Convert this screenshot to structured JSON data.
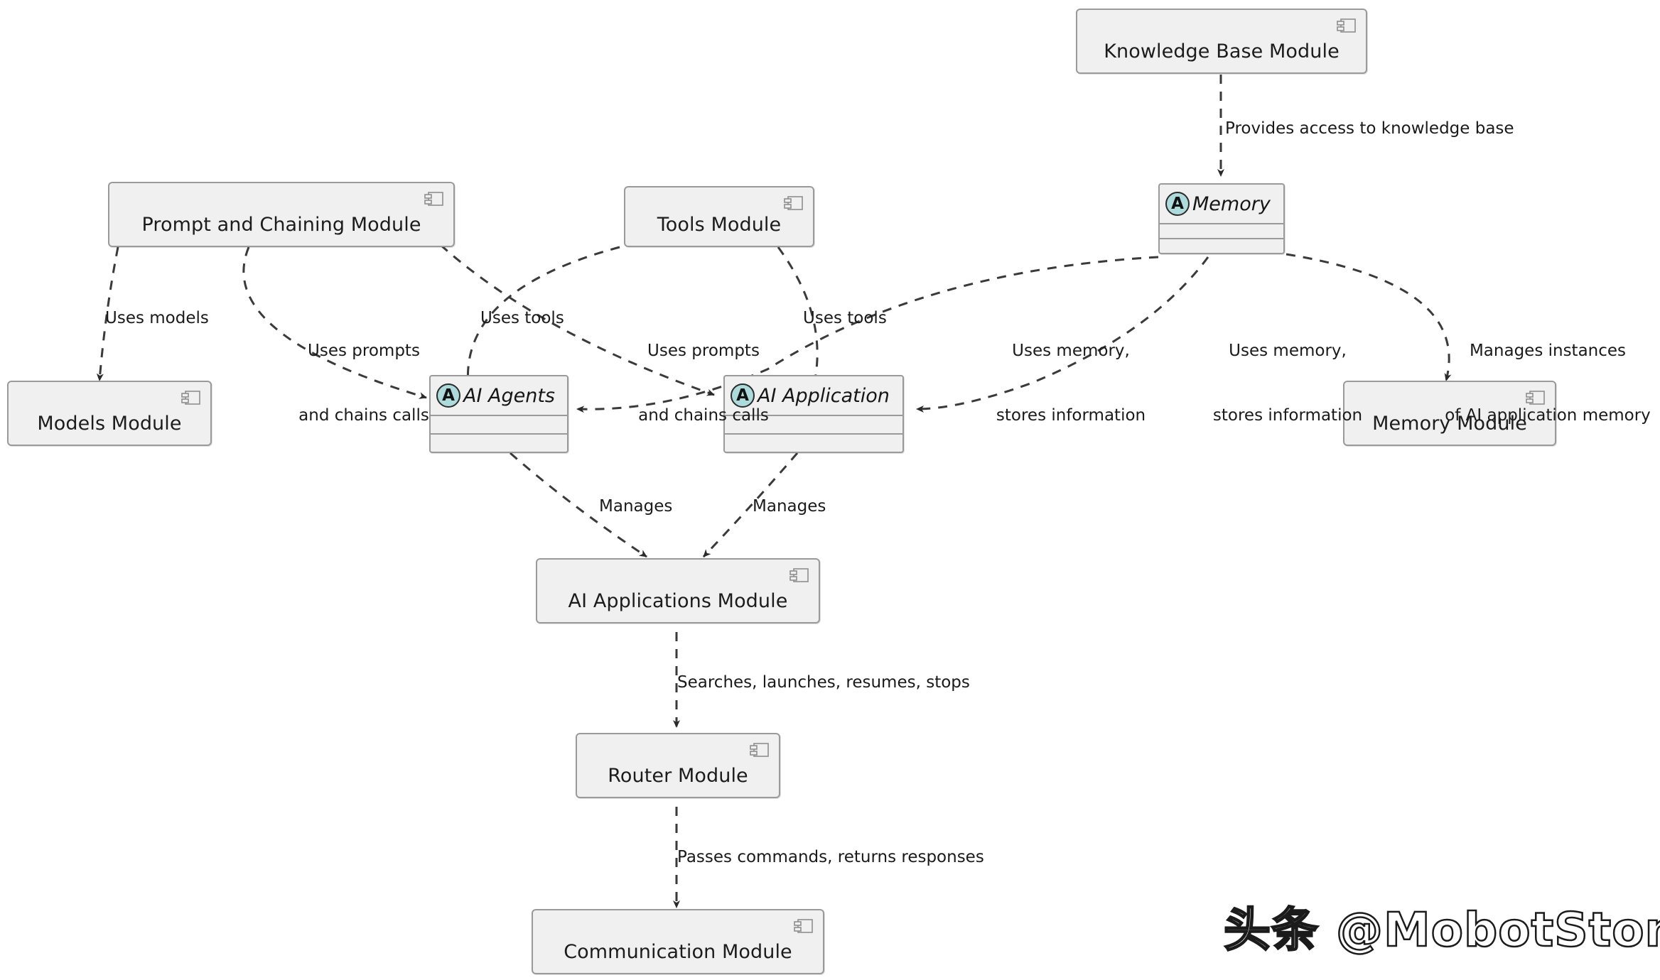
{
  "diagram": {
    "type": "uml-component-diagram",
    "background": "#ffffff",
    "node_fill": "#F0F0F0",
    "node_border": "#9A9A9A",
    "abstract_badge_fill": "#ADDBDB",
    "edge_color": "#3a3a3a",
    "edge_style": "dashed-with-arrowhead"
  },
  "nodes": {
    "knowledge_base_module": {
      "label": "Knowledge Base Module",
      "kind": "component"
    },
    "prompt_chaining_module": {
      "label": "Prompt and Chaining Module",
      "kind": "component"
    },
    "tools_module": {
      "label": "Tools Module",
      "kind": "component"
    },
    "models_module": {
      "label": "Models Module",
      "kind": "component"
    },
    "memory_module": {
      "label": "Memory Module",
      "kind": "component"
    },
    "ai_applications_module": {
      "label": "AI Applications Module",
      "kind": "component"
    },
    "router_module": {
      "label": "Router Module",
      "kind": "component"
    },
    "communication_module": {
      "label": "Communication Module",
      "kind": "component"
    },
    "memory": {
      "label": "Memory",
      "kind": "abstract-class",
      "badge": "A"
    },
    "ai_agents": {
      "label": "AI Agents",
      "kind": "abstract-class",
      "badge": "A"
    },
    "ai_application": {
      "label": "AI Application",
      "kind": "abstract-class",
      "badge": "A"
    }
  },
  "edges": [
    {
      "id": "kb-to-memory",
      "from": "knowledge_base_module",
      "to": "memory",
      "label": "Provides access to knowledge base"
    },
    {
      "id": "prompt-to-models",
      "from": "prompt_chaining_module",
      "to": "models_module",
      "label": "Uses models"
    },
    {
      "id": "prompt-to-agents",
      "from": "prompt_chaining_module",
      "to": "ai_agents",
      "label_line1": "Uses prompts",
      "label_line2": "and chains calls"
    },
    {
      "id": "tools-to-agents",
      "from": "tools_module",
      "to": "ai_agents",
      "label": "Uses tools"
    },
    {
      "id": "prompt-to-app",
      "from": "prompt_chaining_module",
      "to": "ai_application",
      "label_line1": "Uses prompts",
      "label_line2": "and chains calls"
    },
    {
      "id": "tools-to-app",
      "from": "tools_module",
      "to": "ai_application",
      "label": "Uses tools"
    },
    {
      "id": "memory-to-agents",
      "from": "memory",
      "to": "ai_agents",
      "label_line1": "Uses memory,",
      "label_line2": "stores information"
    },
    {
      "id": "memory-to-app",
      "from": "memory",
      "to": "ai_application",
      "label_line1": "Uses memory,",
      "label_line2": "stores information"
    },
    {
      "id": "memory-to-memmodule",
      "from": "memory",
      "to": "memory_module",
      "label_line1": "Manages instances",
      "label_line2": "of AI application memory"
    },
    {
      "id": "agents-to-aiapps",
      "from": "ai_agents",
      "to": "ai_applications_module",
      "label": "Manages"
    },
    {
      "id": "app-to-aiapps",
      "from": "ai_application",
      "to": "ai_applications_module",
      "label": "Manages"
    },
    {
      "id": "aiapps-to-router",
      "from": "ai_applications_module",
      "to": "router_module",
      "label": "Searches, launches, resumes, stops"
    },
    {
      "id": "router-to-comm",
      "from": "router_module",
      "to": "communication_module",
      "label": "Passes commands, returns responses"
    }
  ],
  "watermark": {
    "text": "头条 @MobotStone"
  }
}
